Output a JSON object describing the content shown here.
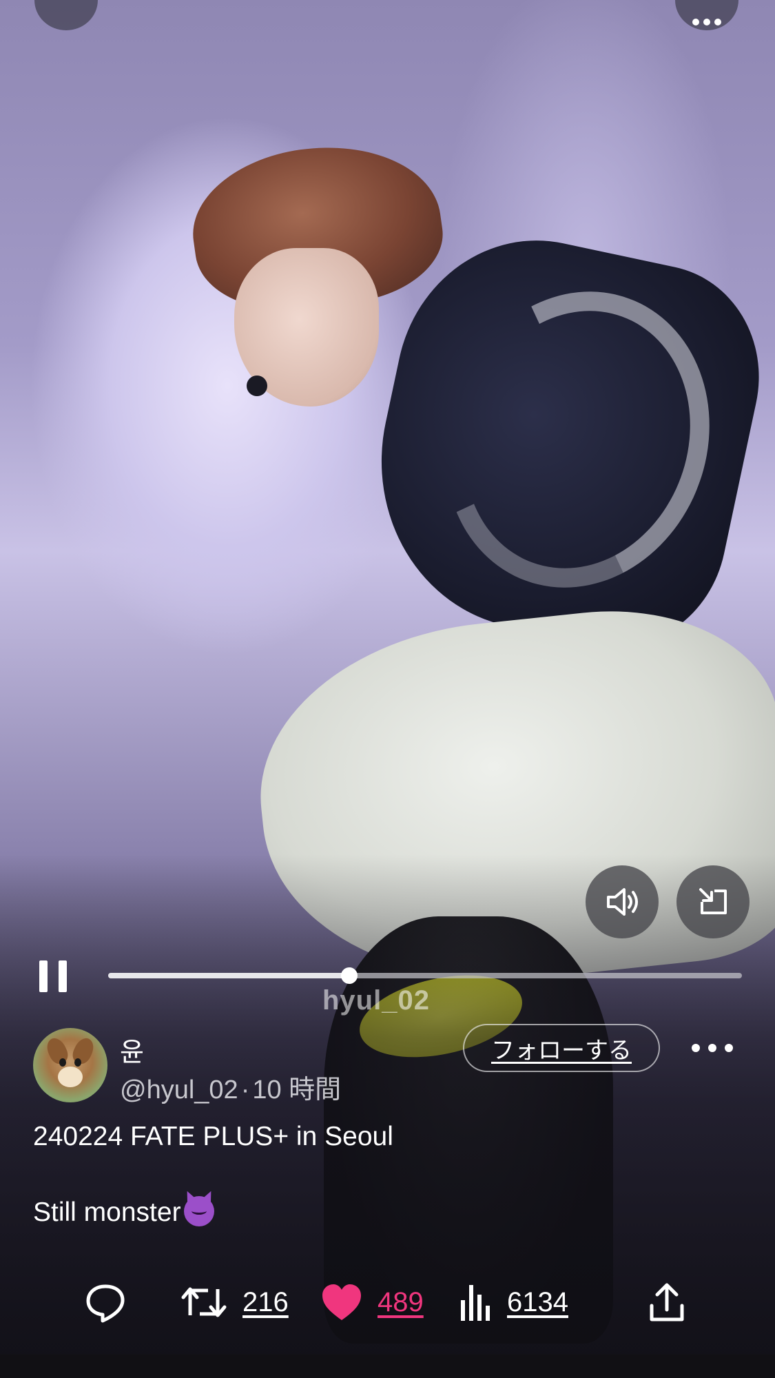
{
  "video": {
    "watermark": "hyul_02",
    "progress_fraction": 0.38
  },
  "post": {
    "display_name": "윤",
    "handle": "@hyul_02",
    "separator": "·",
    "time_ago": "10 時間",
    "follow_label": "フォローする",
    "caption_line1": "240224 FATE PLUS+ in Seoul",
    "caption_line2": "Still monster",
    "caption_emoji": "smiling-imp-emoji"
  },
  "actions": {
    "retweets": "216",
    "likes": "489",
    "views": "6134"
  },
  "colors": {
    "like_pink": "#f0367e",
    "control_bg": "#46464b",
    "text": "#ffffff"
  },
  "icons": [
    "back-icon",
    "more-icon",
    "volume-icon",
    "pip-icon",
    "pause-icon",
    "more-dots-icon",
    "reply-icon",
    "retweet-icon",
    "heart-icon",
    "views-icon",
    "share-icon"
  ]
}
